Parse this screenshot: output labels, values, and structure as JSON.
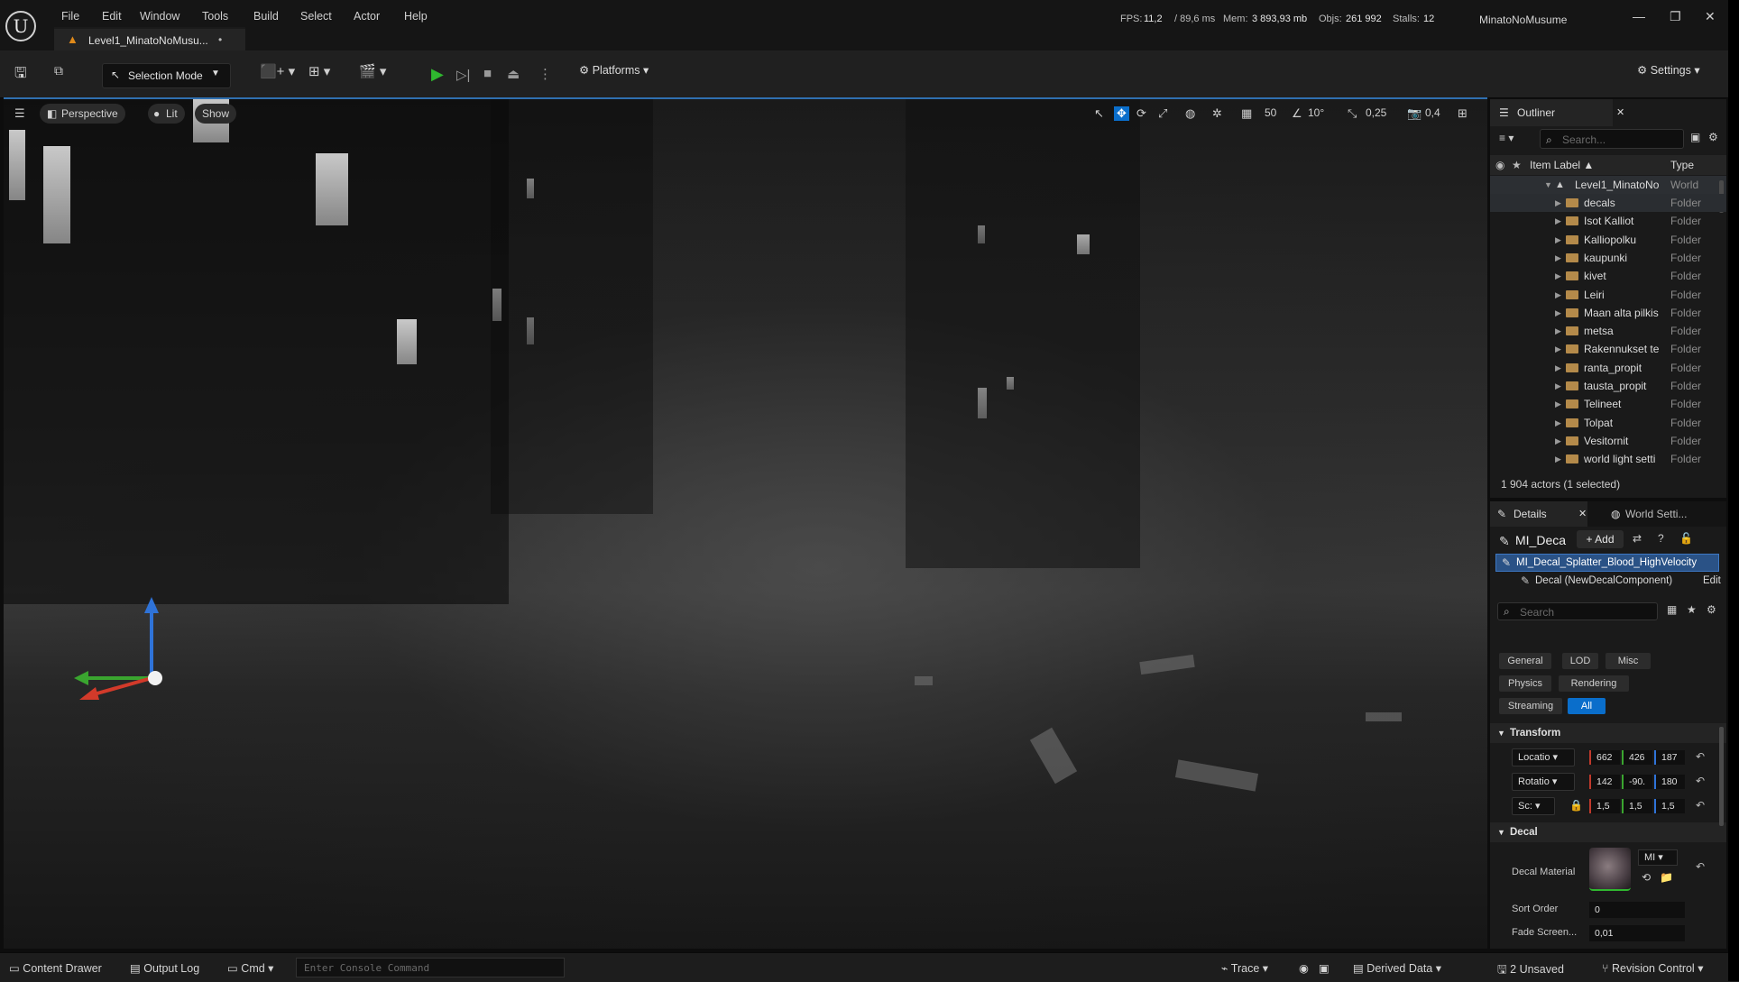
{
  "menu": [
    "File",
    "Edit",
    "Window",
    "Tools",
    "Build",
    "Select",
    "Actor",
    "Help"
  ],
  "stats": {
    "fps_label": "FPS:",
    "fps": "11,2",
    "ms": "/ 89,6 ms",
    "mem_label": "Mem:",
    "mem": "3 893,93 mb",
    "objs_label": "Objs:",
    "objs": "261 992",
    "stalls_label": "Stalls:",
    "stalls": "12"
  },
  "project_name": "MinatoNoMusume",
  "level_tab": {
    "label": "Level1_MinatoNoMusu...",
    "modified": "•"
  },
  "toolbar": {
    "selection_mode": "Selection Mode",
    "platforms": "Platforms",
    "settings": "Settings"
  },
  "viewport": {
    "perspective": "Perspective",
    "lit": "Lit",
    "show": "Show",
    "grid_snap": "50",
    "rot_snap": "10°",
    "scale_snap": "0,25",
    "camera_speed": "0,4"
  },
  "outliner": {
    "title": "Outliner",
    "search_placeholder": "Search...",
    "col_label": "Item Label ▲",
    "col_type": "Type",
    "root": {
      "name": "Level1_MinatoNo",
      "type": "World"
    },
    "items": [
      {
        "name": "decals",
        "type": "Folder"
      },
      {
        "name": "Isot Kalliot",
        "type": "Folder"
      },
      {
        "name": "Kalliopolku",
        "type": "Folder"
      },
      {
        "name": "kaupunki",
        "type": "Folder"
      },
      {
        "name": "kivet",
        "type": "Folder"
      },
      {
        "name": "Leiri",
        "type": "Folder"
      },
      {
        "name": "Maan alta pilkis",
        "type": "Folder"
      },
      {
        "name": "metsa",
        "type": "Folder"
      },
      {
        "name": "Rakennukset te",
        "type": "Folder"
      },
      {
        "name": "ranta_propit",
        "type": "Folder"
      },
      {
        "name": "tausta_propit",
        "type": "Folder"
      },
      {
        "name": "Telineet",
        "type": "Folder"
      },
      {
        "name": "Tolpat",
        "type": "Folder"
      },
      {
        "name": "Vesitornit",
        "type": "Folder"
      },
      {
        "name": "world light setti",
        "type": "Folder"
      }
    ],
    "status": "1 904 actors (1 selected)"
  },
  "details": {
    "tab": "Details",
    "tab2": "World Setti...",
    "actor_name": "MI_Deca",
    "add": "+ Add",
    "component_selected": "MI_Decal_Splatter_Blood_HighVelocity",
    "component_child": "Decal (NewDecalComponent)",
    "edit": "Edit",
    "search_placeholder": "Search",
    "filters": [
      "General",
      "LOD",
      "Misc",
      "Physics",
      "Rendering",
      "Streaming",
      "All"
    ],
    "transform_header": "Transform",
    "location_label": "Locatio",
    "location": [
      "662",
      "426",
      "187"
    ],
    "rotation_label": "Rotatio",
    "rotation": [
      "142",
      "-90.",
      "180"
    ],
    "scale_label": "Sc:",
    "scale": [
      "1,5",
      "1,5",
      "1,5"
    ],
    "decal_header": "Decal",
    "decal_material_label": "Decal Material",
    "decal_material_value": "MI",
    "sort_order_label": "Sort Order",
    "sort_order": "0",
    "fade_label": "Fade Screen...",
    "fade": "0,01"
  },
  "bottom": {
    "content_drawer": "Content Drawer",
    "output_log": "Output Log",
    "cmd": "Cmd",
    "console_placeholder": "Enter Console Command",
    "trace": "Trace",
    "derived_data": "Derived Data",
    "unsaved": "2 Unsaved",
    "revision": "Revision Control"
  },
  "colors": {
    "accent": "#0a6ecb",
    "folder": "#b48a4a",
    "level_icon": "#e08a1a",
    "play": "#2fb72f"
  }
}
